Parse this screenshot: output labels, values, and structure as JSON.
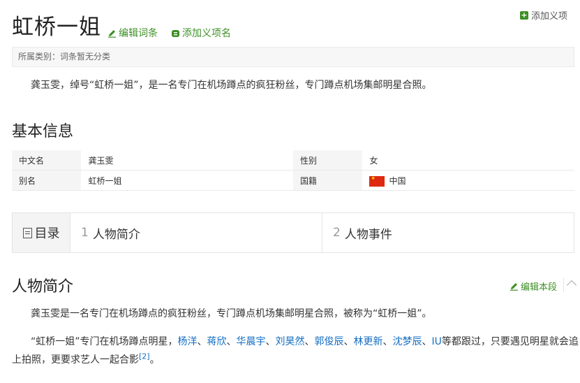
{
  "header": {
    "title": "虹桥一姐",
    "edit_entry_label": "编辑词条",
    "add_sense_label": "添加义项名",
    "add_sense_top_label": "添加义项"
  },
  "category": {
    "text": "所属类别：词条暂无分类"
  },
  "summary": "龚玉雯，绰号“虹桥一姐”，是一名专门在机场蹲点的疯狂粉丝，专门蹲点机场集邮明星合照。",
  "basic_info": {
    "heading": "基本信息",
    "rows": [
      {
        "k1": "中文名",
        "v1": "龚玉雯",
        "k2": "性别",
        "v2": "女"
      },
      {
        "k1": "别名",
        "v1": "虹桥一姐",
        "k2": "国籍",
        "v2": "中国"
      }
    ]
  },
  "toc": {
    "label": "目录",
    "items": [
      {
        "num": "1",
        "label": "人物简介"
      },
      {
        "num": "2",
        "label": "人物事件"
      }
    ]
  },
  "profile": {
    "heading": "人物简介",
    "edit_label": "编辑本段",
    "para1": "龚玉雯是一名专门在机场蹲点的疯狂粉丝，专门蹲点机场集邮明星合照，被称为“虹桥一姐”。",
    "para2_prefix": "“虹桥一姐”专门在机场蹲点明星，",
    "stars": [
      "杨洋",
      "蒋欣",
      "华晨宇",
      "刘昊然",
      "郭俊辰",
      "林更新",
      "沈梦辰",
      "IU"
    ],
    "separator": "、",
    "para2_suffix_line1": "等都跟过，只要遇见明星就会追",
    "para2_line2": "上拍照，更要求艺人一起合影",
    "ref": "[2]",
    "para2_end": "。"
  },
  "colors": {
    "green": "#3e8f26",
    "link": "#136ec2",
    "flag_red": "#de2910"
  }
}
